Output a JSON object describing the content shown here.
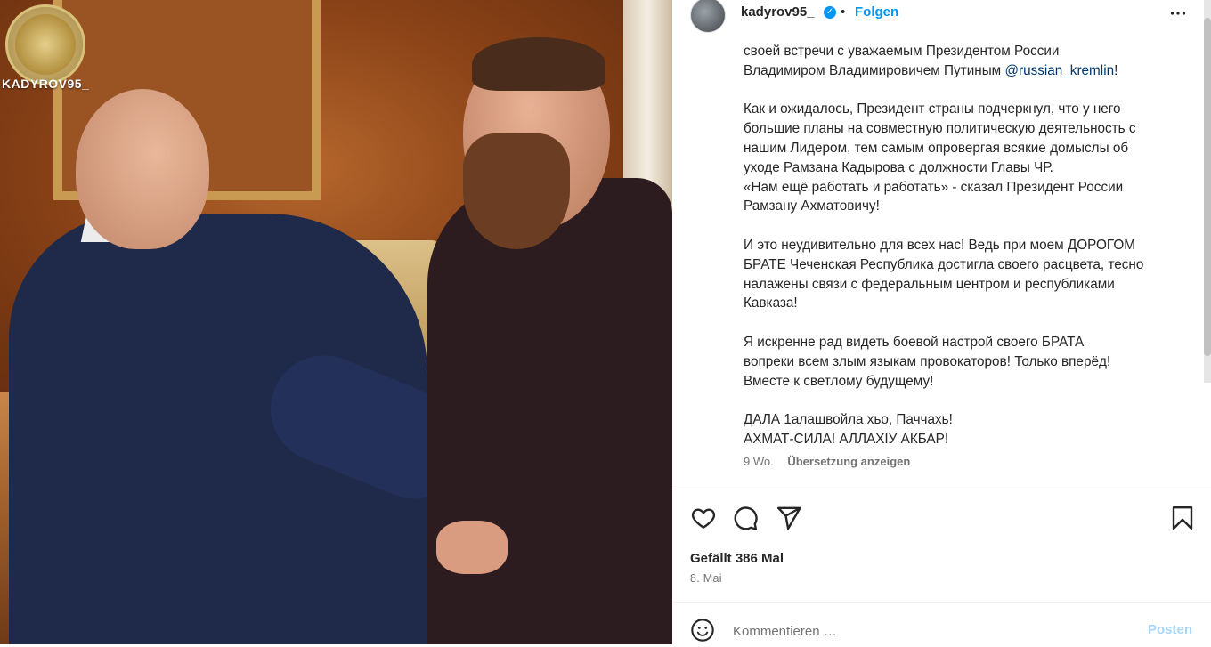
{
  "photo": {
    "watermark": "KADYROV95_"
  },
  "post": {
    "username": "kadyrov95_",
    "separator": "•",
    "follow_label": "Folgen",
    "more_label": "•••",
    "verified_mark": "✓"
  },
  "caption": {
    "line1": "своей встречи с уважаемым Президентом России",
    "line2_text": "Владимиром Владимировичем Путиным ",
    "line2_mention": "@russian_kremlin",
    "line2_end": "!",
    "para2": [
      "Как и ожидалось, Президент страны подчеркнул, что у него",
      "большие планы на совместную политическую деятельность с",
      "нашим Лидером, тем самым опровергая всякие домыслы об",
      "уходе Рамзана Кадырова с должности Главы ЧР.",
      "«Нам ещё работать и работать» - сказал Президент России",
      "Рамзану Ахматовичу!"
    ],
    "para3": [
      "И это неудивительно для всех нас! Ведь при моем ДОРОГОМ",
      "БРАТЕ Чеченская Республика достигла своего расцвета, тесно",
      "налажены связи с федеральным центром и республиками",
      "Кавказа!"
    ],
    "para4": [
      "Я искренне рад видеть боевой настрой своего БРАТА",
      "вопреки всем злым языкам провокаторов! Только вперёд!",
      "Вместе к светлому будущему!"
    ],
    "para5": [
      "ДАЛА 1алашвойла хьо, Паччахь!",
      "АХМАТ-СИЛА! АЛЛАХIУ АКБАР!"
    ]
  },
  "meta": {
    "age": "9 Wo.",
    "translate_label": "Übersetzung anzeigen"
  },
  "engagement": {
    "likes": "Gefällt 386 Mal",
    "date": "8. Mai"
  },
  "actions": {
    "icons": [
      "heart-icon",
      "comment-icon",
      "share-icon",
      "bookmark-icon"
    ]
  },
  "comment": {
    "placeholder": "Kommentieren …",
    "post_label": "Posten"
  },
  "colors": {
    "accent": "#0095f6",
    "post_disabled": "#a8d6fb",
    "mention": "#00376b",
    "muted": "#737373"
  }
}
